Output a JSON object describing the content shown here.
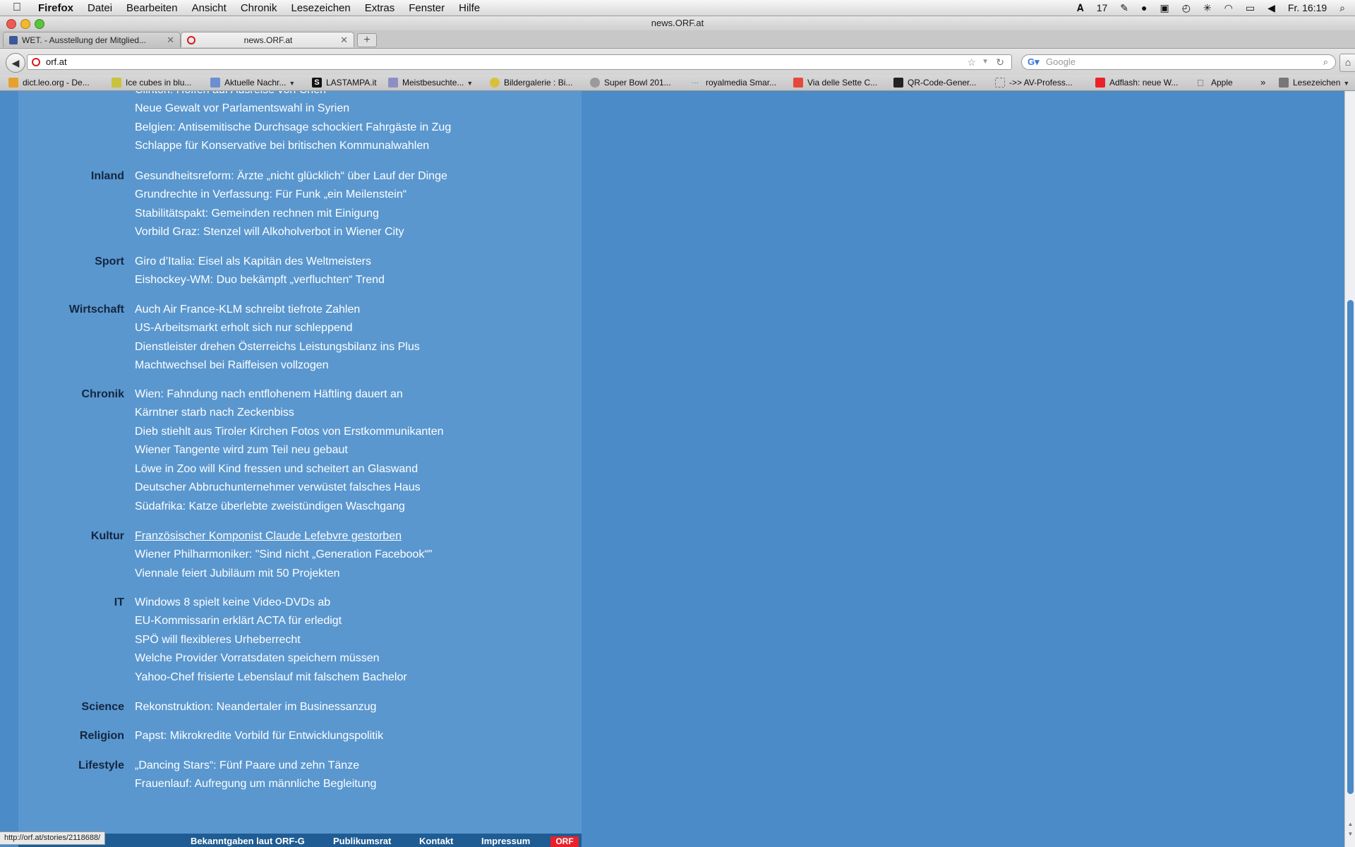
{
  "menubar": {
    "app": "Firefox",
    "items": [
      "Datei",
      "Bearbeiten",
      "Ansicht",
      "Chronik",
      "Lesezeichen",
      "Extras",
      "Fenster",
      "Hilfe"
    ],
    "status_count": "17",
    "clock": "Fr. 16:19"
  },
  "window": {
    "title": "news.ORF.at"
  },
  "tabs": [
    {
      "label": "WET. - Ausstellung der Mitglied...",
      "active": false
    },
    {
      "label": "news.ORF.at",
      "active": true
    }
  ],
  "toolbar": {
    "url": "orf.at",
    "search_placeholder": "Google"
  },
  "bookmarks": [
    "dict.leo.org - De...",
    "Ice cubes in blu...",
    "Aktuelle Nachr...",
    "LASTAMPA.it",
    "Meistbesuchte...",
    "Bildergalerie : Bi...",
    "Super Bowl 201...",
    "royalmedia Smar...",
    "Via delle Sette C...",
    "QR-Code-Gener...",
    "->> AV-Profess...",
    "Adflash: neue W...",
    "Apple",
    "Lesezeichen"
  ],
  "news": {
    "top_partial": [
      "Clinton: Hoffen auf Ausreise von Chen",
      "Neue Gewalt vor Parlamentswahl in Syrien",
      "Belgien: Antisemitische Durchsage schockiert Fahrgäste in Zug",
      "Schlappe für Konservative bei britischen Kommunalwahlen"
    ],
    "sections": [
      {
        "label": "Inland",
        "stories": [
          "Gesundheitsreform: Ärzte „nicht glücklich“ über Lauf der Dinge",
          "Grundrechte in Verfassung: Für Funk „ein Meilenstein“",
          "Stabilitätspakt: Gemeinden rechnen mit Einigung",
          "Vorbild Graz: Stenzel will Alkoholverbot in Wiener City"
        ]
      },
      {
        "label": "Sport",
        "stories": [
          "Giro d’Italia: Eisel als Kapitän des Weltmeisters",
          "Eishockey-WM: Duo bekämpft „verfluchten“ Trend"
        ]
      },
      {
        "label": "Wirtschaft",
        "stories": [
          "Auch Air France-KLM schreibt tiefrote Zahlen",
          "US-Arbeitsmarkt erholt sich nur schleppend",
          "Dienstleister drehen Österreichs Leistungsbilanz ins Plus",
          "Machtwechsel bei Raiffeisen vollzogen"
        ]
      },
      {
        "label": "Chronik",
        "stories": [
          "Wien: Fahndung nach entflohenem Häftling dauert an",
          "Kärntner starb nach Zeckenbiss",
          "Dieb stiehlt aus Tiroler Kirchen Fotos von Erstkommunikanten",
          "Wiener Tangente wird zum Teil neu gebaut",
          "Löwe in Zoo will Kind fressen und scheitert an Glaswand",
          "Deutscher Abbruchunternehmer verwüstet falsches Haus",
          "Südafrika: Katze überlebte zweistündigen Waschgang"
        ]
      },
      {
        "label": "Kultur",
        "stories": [
          "Französischer Komponist Claude Lefebvre gestorben",
          "Wiener Philharmoniker: \"Sind nicht „Generation Facebook“\"",
          "Viennale feiert Jubiläum mit 50 Projekten"
        ]
      },
      {
        "label": "IT",
        "stories": [
          "Windows 8 spielt keine Video-DVDs ab",
          "EU-Kommissarin erklärt ACTA für erledigt",
          "SPÖ will flexibleres Urheberrecht",
          "Welche Provider Vorratsdaten speichern müssen",
          "Yahoo-Chef frisierte Lebenslauf mit falschem Bachelor"
        ]
      },
      {
        "label": "Science",
        "stories": [
          "Rekonstruktion: Neandertaler im Businessanzug"
        ]
      },
      {
        "label": "Religion",
        "stories": [
          "Papst: Mikrokredite Vorbild für Entwicklungspolitik"
        ]
      },
      {
        "label": "Lifestyle",
        "stories": [
          "„Dancing Stars“: Fünf Paare und zehn Tänze",
          "Frauenlauf: Aufregung um männliche Begleitung"
        ]
      }
    ]
  },
  "footer": {
    "links": [
      "Bekanntgaben laut ORF-G",
      "Publikumsrat",
      "Kontakt",
      "Impressum"
    ],
    "logo": "ORF"
  },
  "status": {
    "hover_url": "http://orf.at/stories/2118688/"
  },
  "colors": {
    "page_bg": "#4a8bc8",
    "content_bg": "#5a97cf",
    "label": "#14263f",
    "story": "#ffffff",
    "footer": "#1f5c93",
    "orf_red": "#e8212b"
  }
}
